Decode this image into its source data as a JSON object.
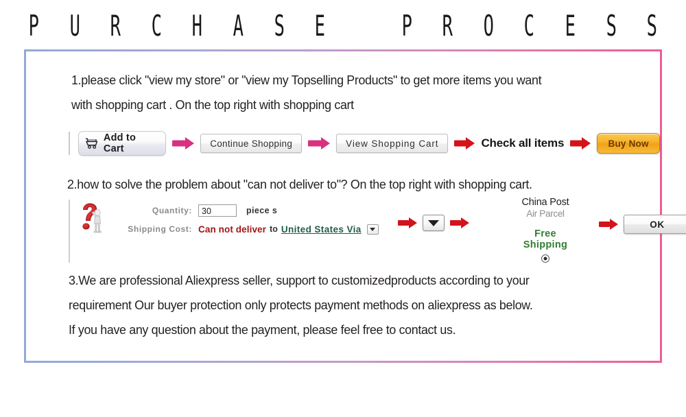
{
  "header": {
    "title": "PURCHASE PROCESS",
    "letters": [
      "P",
      "U",
      "R",
      "C",
      "H",
      "A",
      "S",
      "E",
      "",
      "P",
      "R",
      "O",
      "C",
      "E",
      "S",
      "S"
    ],
    "gradient_start": "#93a9d6",
    "gradient_end": "#ee5c96"
  },
  "frame": {
    "border_gradient_start": "#93a9d6",
    "border_gradient_end": "#ee5c96"
  },
  "steps": {
    "step1_text": "1.please click \"view my store\" or \"view my Topselling Products\" to get more items you want with shopping cart . On the top right with shopping cart",
    "step1_line1": "1.please click \"view my store\" or \"view my Topselling Products\" to get more items you want",
    "step1_line2": "with shopping cart . On the top right with shopping cart",
    "step2_text": "2.how to solve the problem about \"can not deliver to\"?  On the top right with shopping cart.",
    "step3_line1": "3.We are professional Aliexpress seller, support to customizedproducts according to your",
    "step3_line2": "requirement   Our buyer protection only protects payment methods on aliexpress as below.",
    "step3_line3": "If you have any question   about the payment, please feel free to contact us."
  },
  "flow1": {
    "add_to_cart": "Add to Cart",
    "continue_shopping": "Continue Shopping",
    "view_shopping_cart": "View Shopping Cart",
    "check_all_items": "Check all items",
    "buy_now": "Buy Now",
    "arrow_pink_color": "#d8317f",
    "arrow_red_color": "#d5121a",
    "buy_now_bg": "#f7b52f"
  },
  "flow2": {
    "quantity_label": "Quantity:",
    "quantity_value": "30",
    "piece_unit": "piece s",
    "shipping_cost_label": "Shipping Cost:",
    "cannot_deliver": "Can not deliver",
    "to_word": "to",
    "country": "United States Via",
    "shipping_method_line1": "China Post",
    "shipping_method_line2": "Air Parcel",
    "free_shipping_line1": "Free",
    "free_shipping_line2": "Shipping",
    "ok_label": "OK",
    "cannot_deliver_color": "#a21515",
    "country_link_color": "#1f5c4a",
    "free_shipping_color": "#2f7d32"
  }
}
